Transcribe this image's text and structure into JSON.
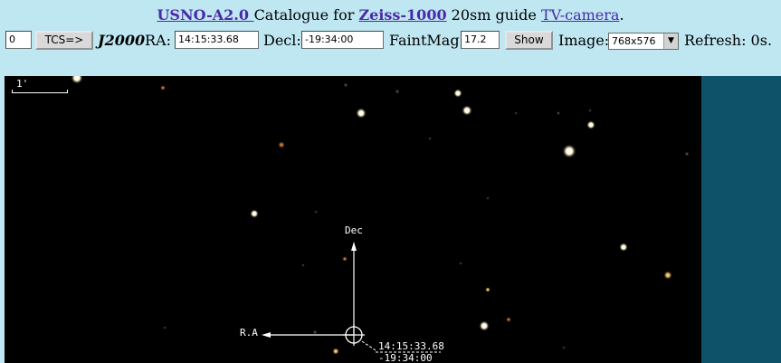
{
  "header": {
    "catalogue_link": "USNO-A2.0 ",
    "catalogue_text": "Catalogue for ",
    "telescope_link": "Zeiss-1000",
    "guide_text": " 20sm guide ",
    "camera_link": "TV-camera",
    "end_dot": "."
  },
  "controls": {
    "counter_value": "0",
    "tcs_button": "TCS=>",
    "epoch": "J2000",
    "ra_label": "RA:",
    "ra_value": "14:15:33.68",
    "decl_label": "Decl:",
    "decl_value": "-19:34:00",
    "faintmag_label": "FaintMag:",
    "faintmag_value": "17.2",
    "show_button": "Show",
    "image_label": "Image:",
    "image_value": "768x576",
    "refresh_label": "Refresh: 0s."
  },
  "sky": {
    "scale_label": "1'",
    "dec_label": "Dec",
    "ra_label": "R.A",
    "target_ra": "14:15:33.68",
    "target_dec": "-19:34:00"
  },
  "colors": {
    "header_bg": "#bfe7f2",
    "link": "#4b2aa8",
    "sky_bg": "#000000",
    "right_panel": "#0d5269"
  }
}
